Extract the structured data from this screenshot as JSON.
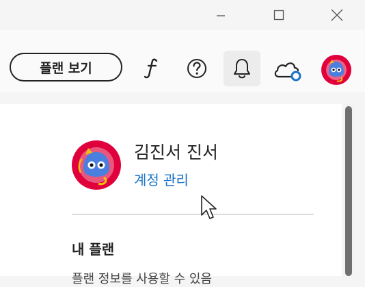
{
  "window_controls": {
    "minimize_icon": "minimize-icon",
    "maximize_icon": "maximize-icon",
    "close_icon": "close-icon"
  },
  "toolbar": {
    "plan_button_label": "플랜 보기",
    "icons": [
      "font-f-icon",
      "help-icon",
      "bell-icon",
      "cloud-sync-icon",
      "avatar-icon"
    ]
  },
  "profile": {
    "name": "김진서 진서",
    "manage_link": "계정 관리"
  },
  "plan_section": {
    "heading": "내 플랜",
    "description": "플랜 정보를 사용할 수 있음"
  },
  "colors": {
    "link": "#1a73c8",
    "avatar_ring": "#e0003c",
    "avatar_face": "#4a7fe0",
    "cloud_badge": "#1a73c8"
  }
}
